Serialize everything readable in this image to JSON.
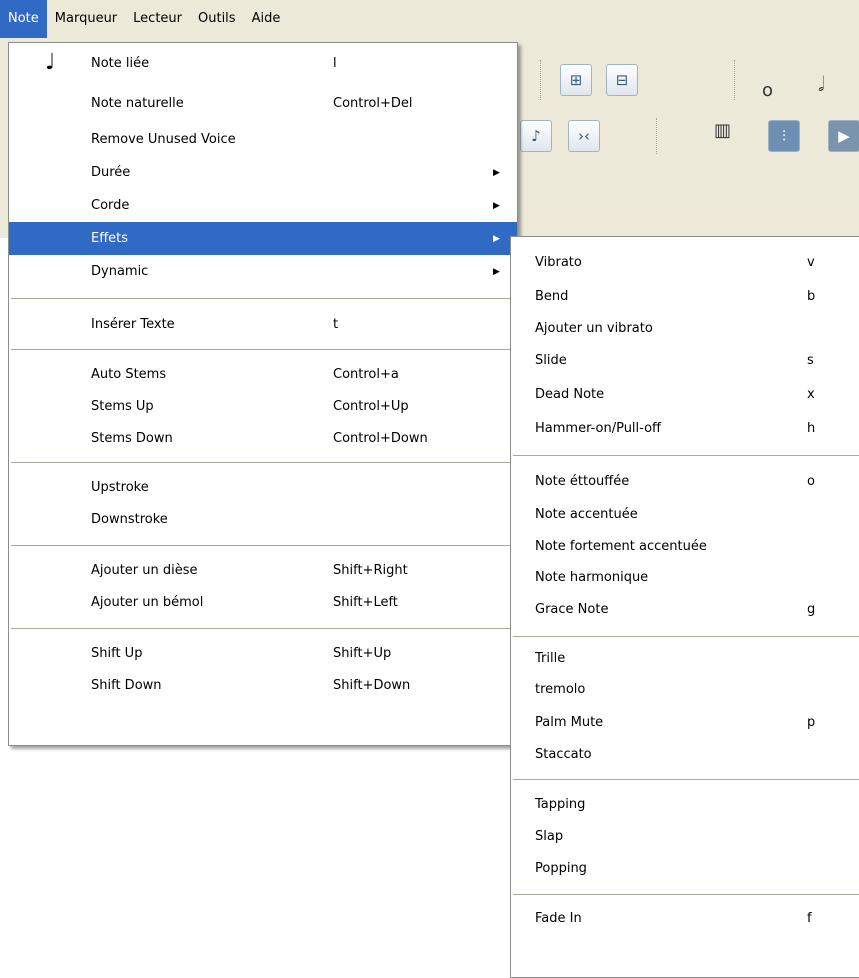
{
  "menubar": {
    "items": [
      "Note",
      "Marqueur",
      "Lecteur",
      "Outils",
      "Aide"
    ]
  },
  "note_menu": {
    "rows": [
      {
        "label": "Note liée",
        "shortcut": "l",
        "icon": "tied-note-icon"
      },
      {
        "label": "Note naturelle",
        "shortcut": "Control+Del"
      },
      {
        "label": "Remove Unused Voice",
        "shortcut": ""
      },
      {
        "label": "Durée",
        "shortcut": "",
        "submenu": true
      },
      {
        "label": "Corde",
        "shortcut": "",
        "submenu": true
      },
      {
        "label": "Effets",
        "shortcut": "",
        "submenu": true,
        "highlighted": true
      },
      {
        "label": "Dynamic",
        "shortcut": "",
        "submenu": true
      },
      {
        "label": "Insérer Texte",
        "shortcut": "t"
      },
      {
        "label": "Auto Stems",
        "shortcut": "Control+a"
      },
      {
        "label": "Stems Up",
        "shortcut": "Control+Up"
      },
      {
        "label": "Stems Down",
        "shortcut": "Control+Down"
      },
      {
        "label": "Upstroke",
        "shortcut": ""
      },
      {
        "label": "Downstroke",
        "shortcut": ""
      },
      {
        "label": "Ajouter un dièse",
        "shortcut": "Shift+Right"
      },
      {
        "label": "Ajouter un bémol",
        "shortcut": "Shift+Left"
      },
      {
        "label": "Shift Up",
        "shortcut": "Shift+Up"
      },
      {
        "label": "Shift Down",
        "shortcut": "Shift+Down"
      }
    ]
  },
  "effets_menu": {
    "rows": [
      {
        "label": "Vibrato",
        "shortcut": "v"
      },
      {
        "label": "Bend",
        "shortcut": "b"
      },
      {
        "label": "Ajouter un vibrato",
        "shortcut": ""
      },
      {
        "label": "Slide",
        "shortcut": "s"
      },
      {
        "label": "Dead Note",
        "shortcut": "x"
      },
      {
        "label": "Hammer-on/Pull-off",
        "shortcut": "h"
      },
      {
        "label": "Note éttouffée",
        "shortcut": "o"
      },
      {
        "label": "Note accentuée",
        "shortcut": ""
      },
      {
        "label": "Note fortement accentuée",
        "shortcut": ""
      },
      {
        "label": "Note harmonique",
        "shortcut": ""
      },
      {
        "label": "Grace Note",
        "shortcut": "g"
      },
      {
        "label": "Trille",
        "shortcut": ""
      },
      {
        "label": "tremolo",
        "shortcut": ""
      },
      {
        "label": "Palm Mute",
        "shortcut": "p"
      },
      {
        "label": "Staccato",
        "shortcut": ""
      },
      {
        "label": "Tapping",
        "shortcut": ""
      },
      {
        "label": "Slap",
        "shortcut": ""
      },
      {
        "label": "Popping",
        "shortcut": ""
      },
      {
        "label": "Fade In",
        "shortcut": "f"
      }
    ]
  },
  "colors": {
    "menubar_bg": "#ece9d8",
    "highlight": "#316ac5",
    "menu_bg": "#ffffff"
  }
}
